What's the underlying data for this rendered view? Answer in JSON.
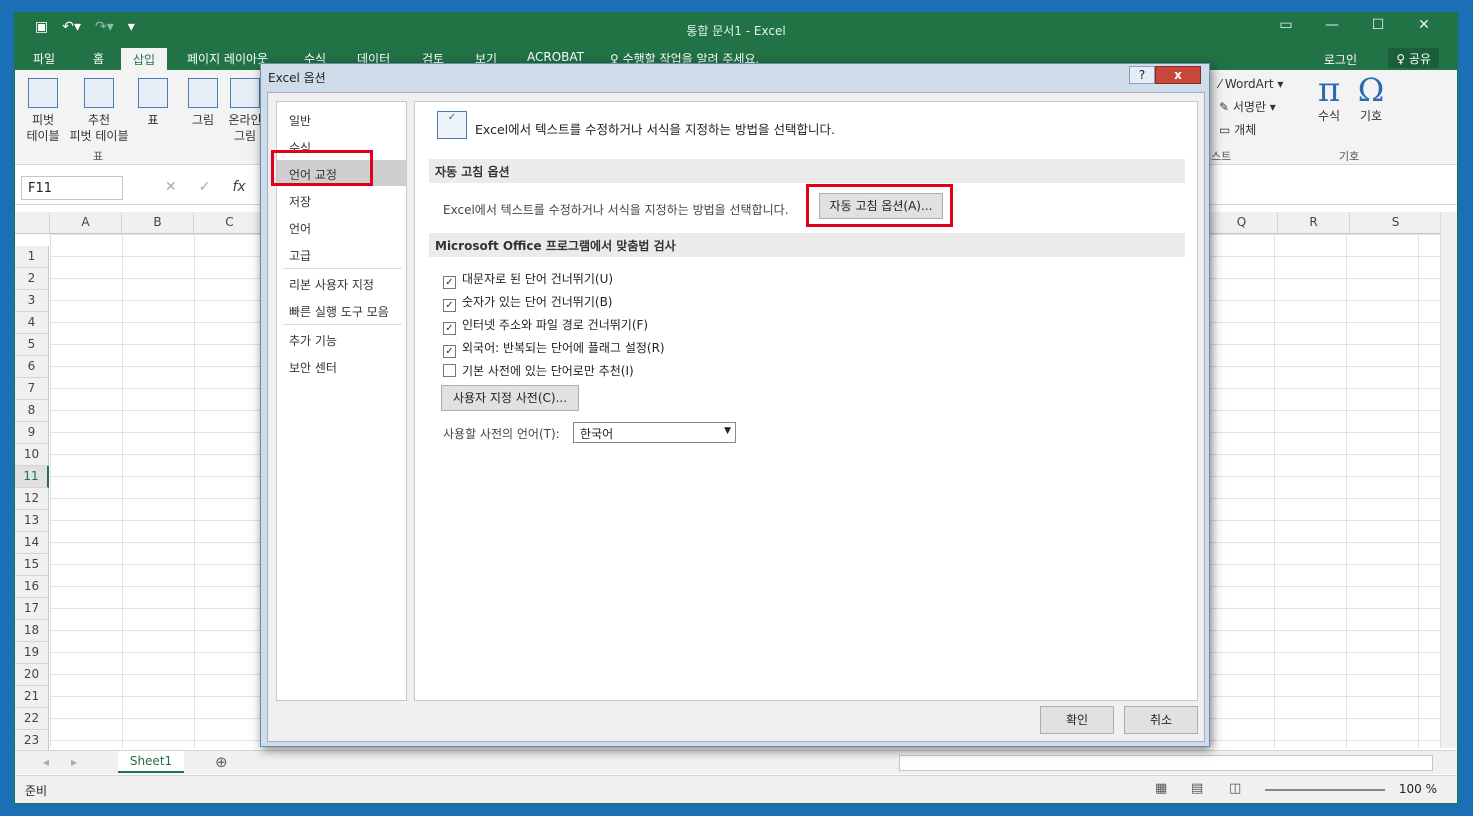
{
  "app": {
    "title": "통합 문서1 - Excel",
    "qat_icons": [
      "save-icon",
      "undo-icon",
      "redo-icon",
      "customize-icon"
    ],
    "tabs": [
      "파일",
      "홈",
      "삽입",
      "페이지 레이아웃",
      "수식",
      "데이터",
      "검토",
      "보기",
      "ACROBAT",
      "♀ 수행할 작업을 알려 주세요."
    ],
    "login": "로그인",
    "share": "♀ 공유"
  },
  "ribbon": {
    "buttons": [
      {
        "label": "피벗\n테이블"
      },
      {
        "label": "추천\n피벗 테이블"
      },
      {
        "label": "표"
      },
      {
        "label": "그림"
      },
      {
        "label": "온라인\n그림"
      },
      {
        "label": "WordArt ▾"
      },
      {
        "label": "서명란 ▾"
      },
      {
        "label": "개체"
      },
      {
        "label": "수식"
      },
      {
        "label": "기호"
      }
    ],
    "groups": [
      "표",
      "스트",
      "기호"
    ],
    "pi": "π",
    "omega": "Ω"
  },
  "formula_bar": {
    "name_box": "F11",
    "fx": "fx"
  },
  "columns": [
    "A",
    "B",
    "C",
    "Q",
    "R",
    "S"
  ],
  "rows": [
    "1",
    "2",
    "3",
    "4",
    "5",
    "6",
    "7",
    "8",
    "9",
    "10",
    "11",
    "12",
    "13",
    "14",
    "15",
    "16",
    "17",
    "18",
    "19",
    "20",
    "21",
    "22",
    "23"
  ],
  "selected_row": "11",
  "sheet_tab": "Sheet1",
  "status": {
    "ready": "준비",
    "zoom": "100 %"
  },
  "dialog": {
    "title": "Excel 옵션",
    "help": "?",
    "close": "x",
    "nav": [
      "일반",
      "수식",
      "언어 교정",
      "저장",
      "언어",
      "고급",
      "리본 사용자 지정",
      "빠른 실행 도구 모음",
      "추가 기능",
      "보안 센터"
    ],
    "selected_nav": "언어 교정",
    "header": "Excel에서 텍스트를 수정하거나 서식을 지정하는 방법을 선택합니다.",
    "autocorrect_section": "자동 고침 옵션",
    "autocorrect_desc": "Excel에서 텍스트를 수정하거나 서식을 지정하는 방법을 선택합니다.",
    "autocorrect_button": "자동 고침 옵션(A)...",
    "spell_section": "Microsoft Office 프로그램에서 맞춤법 검사",
    "checkboxes": [
      {
        "label": "대문자로 된 단어 건너뛰기(U)",
        "checked": true
      },
      {
        "label": "숫자가 있는 단어 건너뛰기(B)",
        "checked": true
      },
      {
        "label": "인터넷 주소와 파일 경로 건너뛰기(F)",
        "checked": true
      },
      {
        "label": "외국어: 반복되는 단어에 플래그 설정(R)",
        "checked": true
      },
      {
        "label": "기본 사전에 있는 단어로만 추천(I)",
        "checked": false
      }
    ],
    "custom_dict_button": "사용자 지정 사전(C)...",
    "dict_lang_label": "사용할 사전의 언어(T):",
    "dict_lang_value": "한국어",
    "ok": "확인",
    "cancel": "취소"
  }
}
